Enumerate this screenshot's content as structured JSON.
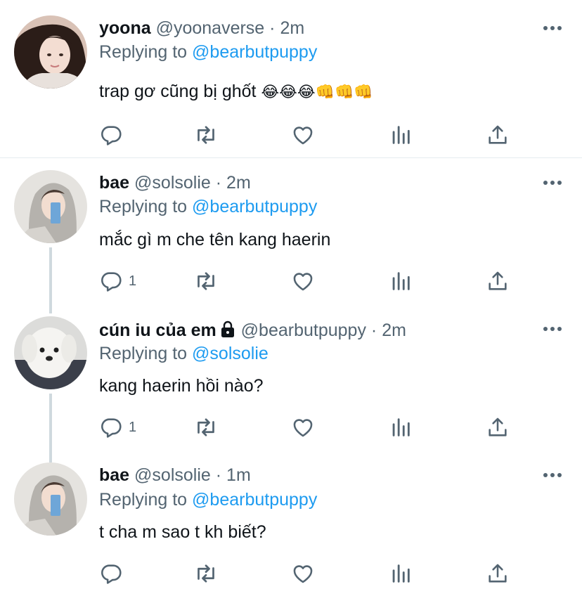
{
  "tweets": [
    {
      "name": "yoona",
      "handle": "@yoonaverse",
      "time": "· 2m",
      "replying_prefix": "Replying to",
      "replying_to": "@bearbutpuppy",
      "text": "trap gơ cũng bị ghốt",
      "emoji": "😂😂😂👊👊👊",
      "reply_count": ""
    },
    {
      "name": "bae",
      "handle": "@solsolie",
      "time": "· 2m",
      "replying_prefix": "Replying to",
      "replying_to": "@bearbutpuppy",
      "text": "mắc gì m che tên kang haerin",
      "reply_count": "1"
    },
    {
      "name": "cún iu của em",
      "handle": "@bearbutpuppy",
      "time": "· 2m",
      "replying_prefix": "Replying to",
      "replying_to": "@solsolie",
      "text": "kang haerin hồi nào?",
      "reply_count": "1"
    },
    {
      "name": "bae",
      "handle": "@solsolie",
      "time": "· 1m",
      "replying_prefix": "Replying to",
      "replying_to": "@bearbutpuppy",
      "text": "t cha m sao t kh biết?",
      "reply_count": ""
    }
  ],
  "colors": {
    "link": "#1d9bf0",
    "secondary_text": "#536471",
    "primary_text": "#0f1419",
    "thread_line": "#cfd9de",
    "separator": "#e6ecf0"
  },
  "icons": {
    "reply": "comment-icon",
    "retweet": "retweet-icon",
    "like": "heart-icon",
    "analytics": "analytics-icon",
    "share": "share-icon",
    "more": "more-icon",
    "protected": "lock-icon"
  }
}
